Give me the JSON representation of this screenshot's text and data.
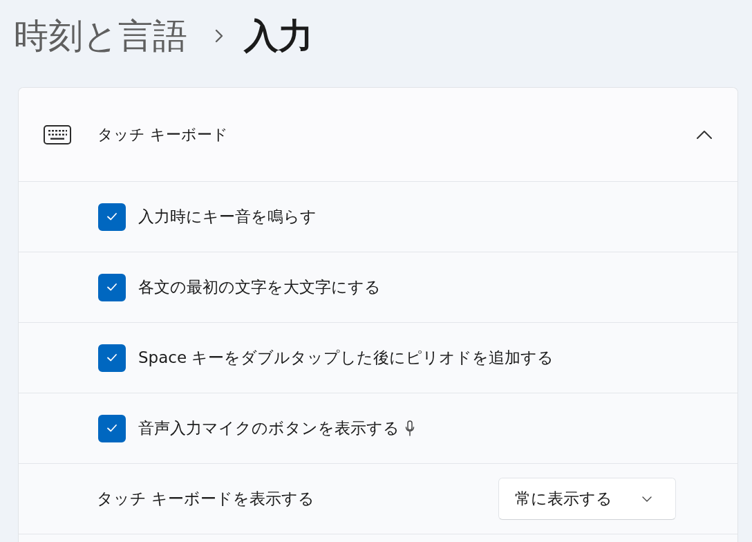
{
  "breadcrumb": {
    "parent": "時刻と言語",
    "current": "入力"
  },
  "section": {
    "title": "タッチ キーボード",
    "expanded": true,
    "options": [
      {
        "label": "入力時にキー音を鳴らす",
        "checked": true,
        "kind": "plain"
      },
      {
        "label": "各文の最初の文字を大文字にする",
        "checked": true,
        "kind": "plain"
      },
      {
        "label": "Space キーをダブルタップした後にピリオドを追加する",
        "checked": true,
        "kind": "plain"
      },
      {
        "label": "音声入力マイクのボタンを表示する",
        "checked": true,
        "kind": "mic"
      }
    ],
    "dropdown_setting": {
      "label": "タッチ キーボードを表示する",
      "value": "常に表示する"
    }
  }
}
